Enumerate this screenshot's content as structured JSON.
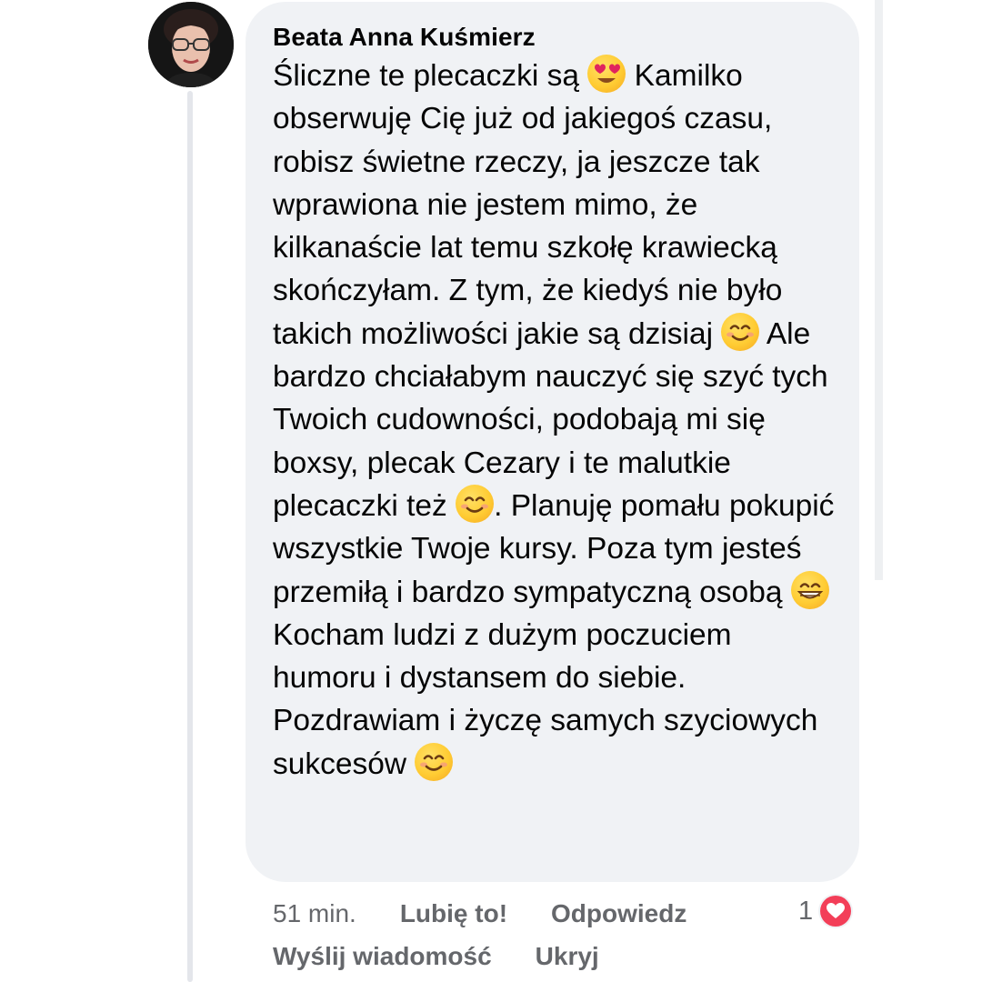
{
  "comment": {
    "author": "Beata Anna Kuśmierz",
    "text_segments": [
      "Śliczne te plecaczki są ",
      " Kamilko obserwuję Cię już od jakiegoś czasu, robisz świetne rzeczy, ja jeszcze tak wprawiona nie jestem mimo, że kilkanaście lat temu szkołę krawiecką skończyłam. Z tym, że kiedyś nie było takich możliwości jakie są dzisiaj ",
      " Ale bardzo chciałabym nauczyć się szyć tych Twoich cudowności, podobają mi się boxsy, plecak Cezary i te malutkie plecaczki też ",
      ". Planuję pomału pokupić wszystkie Twoje kursy. Poza tym jesteś przemiłą i bardzo sympatyczną osobą ",
      " Kocham ludzi z dużym poczuciem humoru i dystansem do siebie. Pozdrawiam i życzę samych szyciowych sukcesów"
    ],
    "emojis": [
      "heart-eyes-emoji",
      "smiling-emoji",
      "smiling-emoji",
      "grinning-emoji",
      "smiling-emoji"
    ]
  },
  "actions": {
    "time": "51 min.",
    "like": "Lubię to!",
    "reply": "Odpowiedz",
    "send_message": "Wyślij wiadomość",
    "hide": "Ukryj"
  },
  "reactions": {
    "count": "1",
    "icon": "heart-icon",
    "color": "#f33e58"
  }
}
